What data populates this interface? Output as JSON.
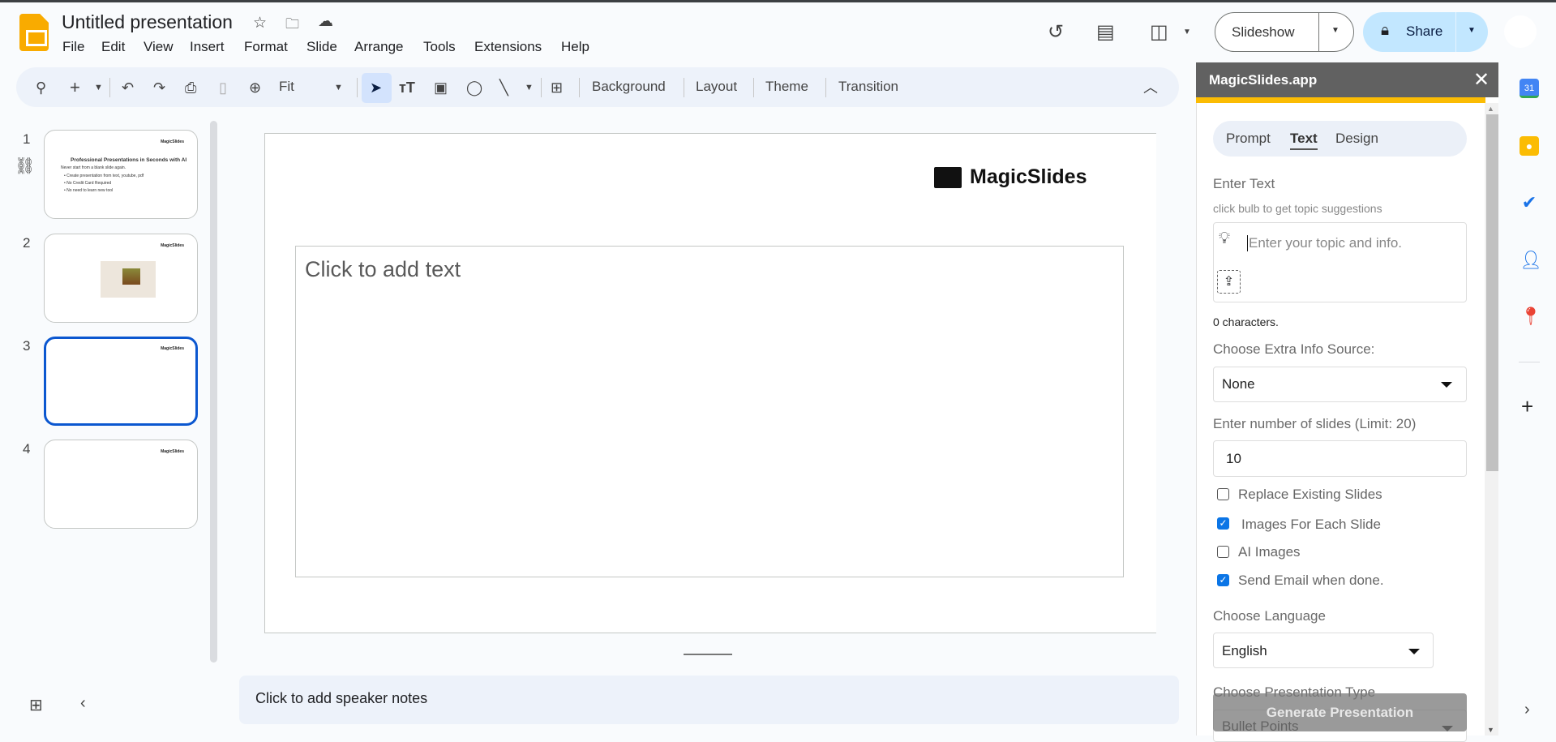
{
  "app": {
    "title": "Untitled presentation"
  },
  "menu": [
    "File",
    "Edit",
    "View",
    "Insert",
    "Format",
    "Slide",
    "Arrange",
    "Tools",
    "Extensions",
    "Help"
  ],
  "toolbar": {
    "zoom": "Fit",
    "background": "Background",
    "layout": "Layout",
    "theme": "Theme",
    "transition": "Transition"
  },
  "header": {
    "slideshow": "Slideshow",
    "share": "Share"
  },
  "filmstrip": {
    "slides": [
      {
        "number": "1",
        "logo": "MagicSlides",
        "title": "Professional Presentations in Seconds with AI",
        "body": "Never start from a blank slide again.",
        "bullets": [
          "Create presentation from text, youtube, pdf",
          "No Credit Card Required",
          "No need to learn new tool"
        ]
      },
      {
        "number": "2",
        "logo": "MagicSlides"
      },
      {
        "number": "3",
        "logo": "MagicSlides"
      },
      {
        "number": "4",
        "logo": "MagicSlides"
      }
    ]
  },
  "editor": {
    "logo": "MagicSlides",
    "placeholder": "Click to add text",
    "notes": "Click to add speaker notes"
  },
  "panel": {
    "title": "MagicSlides.app",
    "tabs": [
      "Prompt",
      "Text",
      "Design"
    ],
    "enter_text": "Enter Text",
    "hint": "click bulb to get topic suggestions",
    "topic_placeholder": "Enter your topic and info.",
    "char_count": "0 characters.",
    "extra_label": "Choose Extra Info Source:",
    "extra_value": "None",
    "slides_label": "Enter number of slides (Limit: 20)",
    "slides_value": "10",
    "options": [
      {
        "label": "Replace Existing Slides",
        "checked": false
      },
      {
        "label": "Images For Each Slide",
        "checked": true
      },
      {
        "label": "AI Images",
        "checked": false
      },
      {
        "label": "Send Email when done.",
        "checked": true
      }
    ],
    "language_label": "Choose Language",
    "language_value": "English",
    "type_label": "Choose Presentation Type",
    "type_value": "Bullet Points",
    "generate": "Generate Presentation"
  },
  "colors": {
    "accent": "#0b57d0",
    "share_bg": "#c2e7ff",
    "panel_header": "#616161",
    "panel_bar": "#fbbc04"
  }
}
